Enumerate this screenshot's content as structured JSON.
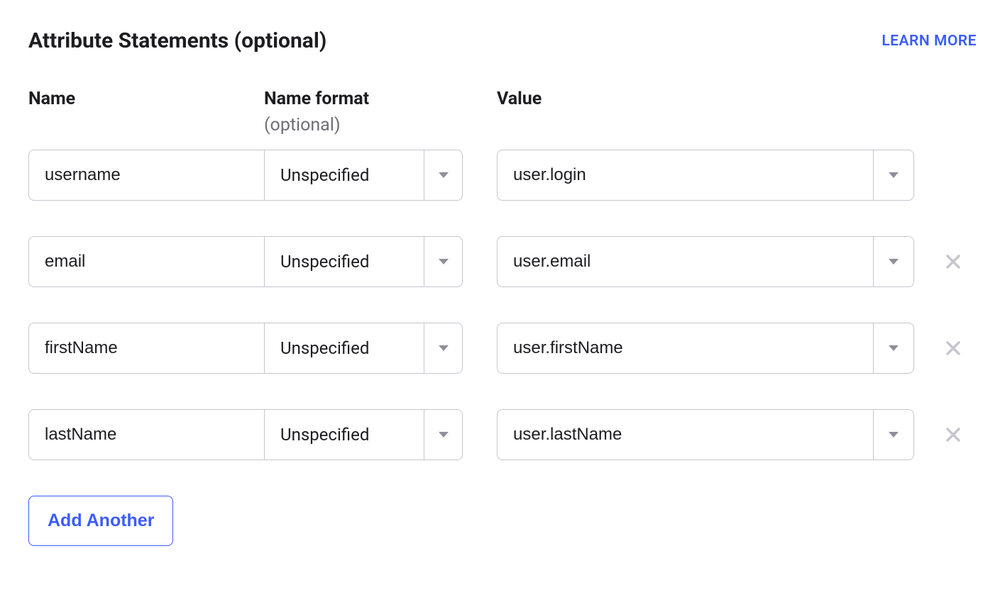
{
  "section": {
    "title": "Attribute Statements (optional)",
    "learn_more": "LEARN MORE"
  },
  "columns": {
    "name": "Name",
    "format": "Name format",
    "format_sub": "(optional)",
    "value": "Value"
  },
  "rows": [
    {
      "name": "username",
      "format": "Unspecified",
      "value": "user.login",
      "removable": false
    },
    {
      "name": "email",
      "format": "Unspecified",
      "value": "user.email",
      "removable": true
    },
    {
      "name": "firstName",
      "format": "Unspecified",
      "value": "user.firstName",
      "removable": true
    },
    {
      "name": "lastName",
      "format": "Unspecified",
      "value": "user.lastName",
      "removable": true
    }
  ],
  "actions": {
    "add_another": "Add Another"
  }
}
